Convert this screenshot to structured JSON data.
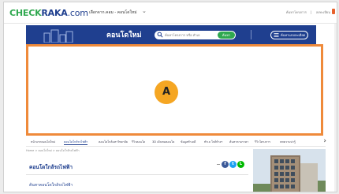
{
  "topbar": {
    "logo_check": "CHECK",
    "logo_raka": "RAKA",
    "logo_com": ".com",
    "region": "เลือกจาก.คอม - คอนโดใหม่",
    "links": [
      "ค้นหาโครงการ",
      "ลงทะเบียน"
    ]
  },
  "hero": {
    "title": "คอนโดใหม่",
    "search_placeholder": "ค้นหาโครงการ หรือ ทำเล",
    "search_button": "ค้นหา",
    "advanced_button": "ค้นหาแบบละเอียด"
  },
  "ad": {
    "badge": "A"
  },
  "nav": {
    "tabs": [
      "หน้าแรกคอนโดใหม่",
      "คอนโดใกล้รถไฟฟ้า",
      "คอนโดใกล้มหาวิทยาลัย",
      "รีวิวคอนโด",
      "3D เดินชมคอนโด",
      "ข้อมูลทำเลดี",
      "ทำเล ใกล้ห้างฯ",
      "ค้นหาตามราคา",
      "รีวิวโครงการ",
      "บทความน่ารู้"
    ],
    "active_index": 1,
    "next_label": "›"
  },
  "breadcrumb": "Home > คอนโดใหม่ > คอนโดใกล้รถไฟฟ้า",
  "content": {
    "title": "คอนโดใกล้รถไฟฟ้า",
    "section_title": "ค้นหาคอนโดใกล้รถไฟฟ้า"
  },
  "share": {
    "facebook": "f",
    "twitter": "t",
    "line": "L"
  },
  "colors": {
    "brand_blue": "#1f3f8f",
    "brand_green": "#2fa84f",
    "ad_border": "#ef8a3a",
    "badge": "#f5a623"
  }
}
